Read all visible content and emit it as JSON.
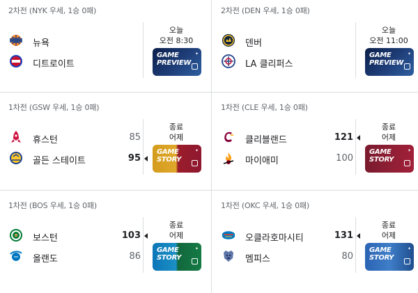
{
  "games": [
    {
      "series": "2차전 (NYK 우세, 1승 0패)",
      "team1": {
        "name": "뉴욕",
        "score": "",
        "logo": "knicks-logo",
        "winner": false
      },
      "team2": {
        "name": "디트로이트",
        "score": "",
        "logo": "pistons-logo",
        "winner": false
      },
      "status1": "오늘",
      "status2": "오전 8:30",
      "thumb": {
        "line1": "GAME",
        "line2": "PREVIEW",
        "style": "preview"
      }
    },
    {
      "series": "2차전 (DEN 우세, 1승 0패)",
      "team1": {
        "name": "덴버",
        "score": "",
        "logo": "nuggets-logo",
        "winner": false
      },
      "team2": {
        "name": "LA 클리퍼스",
        "score": "",
        "logo": "clippers-logo",
        "winner": false
      },
      "status1": "오늘",
      "status2": "오전 11:00",
      "thumb": {
        "line1": "GAME",
        "line2": "PREVIEW",
        "style": "preview"
      }
    },
    {
      "series": "1차전 (GSW 우세, 1승 0패)",
      "team1": {
        "name": "휴스턴",
        "score": "85",
        "logo": "rockets-logo",
        "winner": false
      },
      "team2": {
        "name": "골든 스테이트",
        "score": "95",
        "logo": "warriors-logo",
        "winner": true
      },
      "status1": "종료",
      "status2": "어제",
      "thumb": {
        "line1": "GAME",
        "line2": "STORY",
        "style": "gsw"
      }
    },
    {
      "series": "1차전 (CLE 우세, 1승 0패)",
      "team1": {
        "name": "클리블랜드",
        "score": "121",
        "logo": "cavaliers-logo",
        "winner": true
      },
      "team2": {
        "name": "마이애미",
        "score": "100",
        "logo": "heat-logo",
        "winner": false
      },
      "status1": "종료",
      "status2": "어제",
      "thumb": {
        "line1": "GAME",
        "line2": "STORY",
        "style": "cle"
      }
    },
    {
      "series": "1차전 (BOS 우세, 1승 0패)",
      "team1": {
        "name": "보스턴",
        "score": "103",
        "logo": "celtics-logo",
        "winner": true
      },
      "team2": {
        "name": "올랜도",
        "score": "86",
        "logo": "magic-logo",
        "winner": false
      },
      "status1": "종료",
      "status2": "어제",
      "thumb": {
        "line1": "GAME",
        "line2": "STORY",
        "style": "bos"
      }
    },
    {
      "series": "1차전 (OKC 우세, 1승 0패)",
      "team1": {
        "name": "오클라호마시티",
        "score": "131",
        "logo": "thunder-logo",
        "winner": true
      },
      "team2": {
        "name": "멤피스",
        "score": "80",
        "logo": "grizzlies-logo",
        "winner": false
      },
      "status1": "종료",
      "status2": "어제",
      "thumb": {
        "line1": "GAME",
        "line2": "STORY",
        "style": "okc"
      }
    }
  ]
}
